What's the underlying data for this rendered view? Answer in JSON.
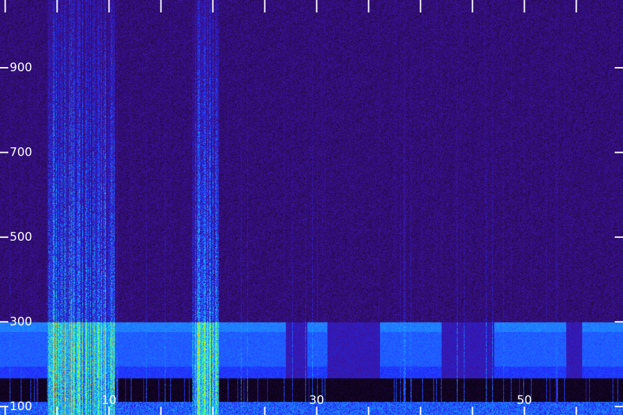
{
  "chart_data": {
    "type": "heatmap",
    "title": "",
    "xlabel": "",
    "ylabel": "",
    "x_tick_labels": [
      "10",
      "30",
      "50"
    ],
    "x_ticks": [
      10,
      30,
      50
    ],
    "y_tick_labels": [
      "100",
      "300",
      "500",
      "700",
      "900"
    ],
    "y_ticks": [
      100,
      300,
      500,
      700,
      900
    ],
    "xlim": [
      -0.5,
      59.5
    ],
    "ylim": [
      80,
      1060
    ],
    "grid": false,
    "legend": "none",
    "colormap": [
      "#000000",
      "#2a0a55",
      "#3a139b",
      "#1f30ff",
      "#1f8fff",
      "#19e0ff",
      "#3dff9a",
      "#b8ff2a",
      "#ffb000",
      "#ff3000"
    ],
    "background_color": "#1a0533",
    "tick_color": "#ffffff",
    "bursts": [
      {
        "x_start": 4,
        "x_end": 10.5,
        "intensity": 0.95
      },
      {
        "x_start": 18,
        "x_end": 20.5,
        "intensity": 0.9
      }
    ],
    "band": {
      "y_low": 85,
      "y_high": 300,
      "note_level": 0.55
    },
    "low_activity": [
      {
        "x_start": 27,
        "x_end": 29
      },
      {
        "x_start": 31,
        "x_end": 36
      },
      {
        "x_start": 42,
        "x_end": 47
      },
      {
        "x_start": 54,
        "x_end": 55.5
      }
    ]
  }
}
